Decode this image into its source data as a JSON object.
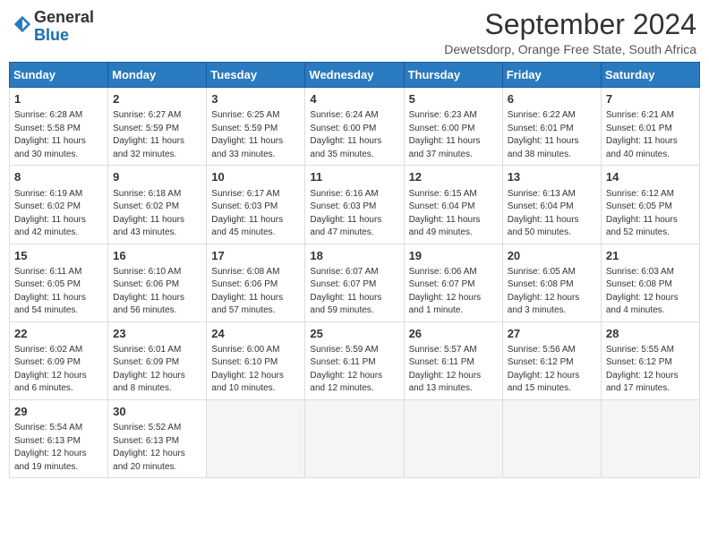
{
  "header": {
    "logo_general": "General",
    "logo_blue": "Blue",
    "month_year": "September 2024",
    "location": "Dewetsdorp, Orange Free State, South Africa"
  },
  "days_of_week": [
    "Sunday",
    "Monday",
    "Tuesday",
    "Wednesday",
    "Thursday",
    "Friday",
    "Saturday"
  ],
  "weeks": [
    [
      {
        "day": "1",
        "sunrise": "Sunrise: 6:28 AM",
        "sunset": "Sunset: 5:58 PM",
        "daylight": "Daylight: 11 hours and 30 minutes."
      },
      {
        "day": "2",
        "sunrise": "Sunrise: 6:27 AM",
        "sunset": "Sunset: 5:59 PM",
        "daylight": "Daylight: 11 hours and 32 minutes."
      },
      {
        "day": "3",
        "sunrise": "Sunrise: 6:25 AM",
        "sunset": "Sunset: 5:59 PM",
        "daylight": "Daylight: 11 hours and 33 minutes."
      },
      {
        "day": "4",
        "sunrise": "Sunrise: 6:24 AM",
        "sunset": "Sunset: 6:00 PM",
        "daylight": "Daylight: 11 hours and 35 minutes."
      },
      {
        "day": "5",
        "sunrise": "Sunrise: 6:23 AM",
        "sunset": "Sunset: 6:00 PM",
        "daylight": "Daylight: 11 hours and 37 minutes."
      },
      {
        "day": "6",
        "sunrise": "Sunrise: 6:22 AM",
        "sunset": "Sunset: 6:01 PM",
        "daylight": "Daylight: 11 hours and 38 minutes."
      },
      {
        "day": "7",
        "sunrise": "Sunrise: 6:21 AM",
        "sunset": "Sunset: 6:01 PM",
        "daylight": "Daylight: 11 hours and 40 minutes."
      }
    ],
    [
      {
        "day": "8",
        "sunrise": "Sunrise: 6:19 AM",
        "sunset": "Sunset: 6:02 PM",
        "daylight": "Daylight: 11 hours and 42 minutes."
      },
      {
        "day": "9",
        "sunrise": "Sunrise: 6:18 AM",
        "sunset": "Sunset: 6:02 PM",
        "daylight": "Daylight: 11 hours and 43 minutes."
      },
      {
        "day": "10",
        "sunrise": "Sunrise: 6:17 AM",
        "sunset": "Sunset: 6:03 PM",
        "daylight": "Daylight: 11 hours and 45 minutes."
      },
      {
        "day": "11",
        "sunrise": "Sunrise: 6:16 AM",
        "sunset": "Sunset: 6:03 PM",
        "daylight": "Daylight: 11 hours and 47 minutes."
      },
      {
        "day": "12",
        "sunrise": "Sunrise: 6:15 AM",
        "sunset": "Sunset: 6:04 PM",
        "daylight": "Daylight: 11 hours and 49 minutes."
      },
      {
        "day": "13",
        "sunrise": "Sunrise: 6:13 AM",
        "sunset": "Sunset: 6:04 PM",
        "daylight": "Daylight: 11 hours and 50 minutes."
      },
      {
        "day": "14",
        "sunrise": "Sunrise: 6:12 AM",
        "sunset": "Sunset: 6:05 PM",
        "daylight": "Daylight: 11 hours and 52 minutes."
      }
    ],
    [
      {
        "day": "15",
        "sunrise": "Sunrise: 6:11 AM",
        "sunset": "Sunset: 6:05 PM",
        "daylight": "Daylight: 11 hours and 54 minutes."
      },
      {
        "day": "16",
        "sunrise": "Sunrise: 6:10 AM",
        "sunset": "Sunset: 6:06 PM",
        "daylight": "Daylight: 11 hours and 56 minutes."
      },
      {
        "day": "17",
        "sunrise": "Sunrise: 6:08 AM",
        "sunset": "Sunset: 6:06 PM",
        "daylight": "Daylight: 11 hours and 57 minutes."
      },
      {
        "day": "18",
        "sunrise": "Sunrise: 6:07 AM",
        "sunset": "Sunset: 6:07 PM",
        "daylight": "Daylight: 11 hours and 59 minutes."
      },
      {
        "day": "19",
        "sunrise": "Sunrise: 6:06 AM",
        "sunset": "Sunset: 6:07 PM",
        "daylight": "Daylight: 12 hours and 1 minute."
      },
      {
        "day": "20",
        "sunrise": "Sunrise: 6:05 AM",
        "sunset": "Sunset: 6:08 PM",
        "daylight": "Daylight: 12 hours and 3 minutes."
      },
      {
        "day": "21",
        "sunrise": "Sunrise: 6:03 AM",
        "sunset": "Sunset: 6:08 PM",
        "daylight": "Daylight: 12 hours and 4 minutes."
      }
    ],
    [
      {
        "day": "22",
        "sunrise": "Sunrise: 6:02 AM",
        "sunset": "Sunset: 6:09 PM",
        "daylight": "Daylight: 12 hours and 6 minutes."
      },
      {
        "day": "23",
        "sunrise": "Sunrise: 6:01 AM",
        "sunset": "Sunset: 6:09 PM",
        "daylight": "Daylight: 12 hours and 8 minutes."
      },
      {
        "day": "24",
        "sunrise": "Sunrise: 6:00 AM",
        "sunset": "Sunset: 6:10 PM",
        "daylight": "Daylight: 12 hours and 10 minutes."
      },
      {
        "day": "25",
        "sunrise": "Sunrise: 5:59 AM",
        "sunset": "Sunset: 6:11 PM",
        "daylight": "Daylight: 12 hours and 12 minutes."
      },
      {
        "day": "26",
        "sunrise": "Sunrise: 5:57 AM",
        "sunset": "Sunset: 6:11 PM",
        "daylight": "Daylight: 12 hours and 13 minutes."
      },
      {
        "day": "27",
        "sunrise": "Sunrise: 5:56 AM",
        "sunset": "Sunset: 6:12 PM",
        "daylight": "Daylight: 12 hours and 15 minutes."
      },
      {
        "day": "28",
        "sunrise": "Sunrise: 5:55 AM",
        "sunset": "Sunset: 6:12 PM",
        "daylight": "Daylight: 12 hours and 17 minutes."
      }
    ],
    [
      {
        "day": "29",
        "sunrise": "Sunrise: 5:54 AM",
        "sunset": "Sunset: 6:13 PM",
        "daylight": "Daylight: 12 hours and 19 minutes."
      },
      {
        "day": "30",
        "sunrise": "Sunrise: 5:52 AM",
        "sunset": "Sunset: 6:13 PM",
        "daylight": "Daylight: 12 hours and 20 minutes."
      },
      null,
      null,
      null,
      null,
      null
    ]
  ]
}
